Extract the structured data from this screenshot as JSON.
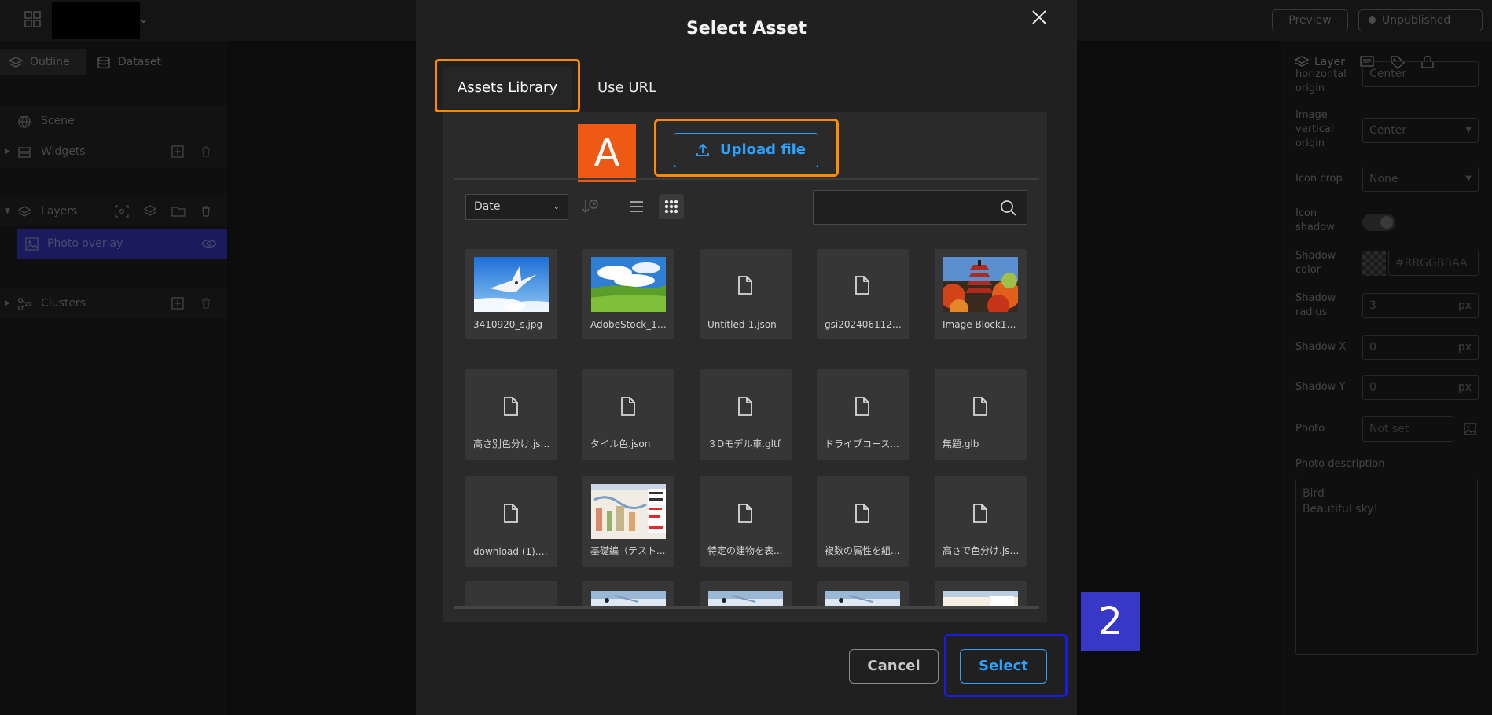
{
  "app": {
    "preview_label": "Preview",
    "publish_status": "Unpublished"
  },
  "left_panel": {
    "tabs": [
      {
        "label": "Outline"
      },
      {
        "label": "Dataset"
      }
    ],
    "scene_label": "Scene",
    "widgets_label": "Widgets",
    "layers_label": "Layers",
    "photo_overlay_label": "Photo overlay",
    "clusters_label": "Clusters"
  },
  "right_panel": {
    "tab_label": "Layer",
    "fields": {
      "horizontal_origin_label": "horizontal origin",
      "horizontal_origin_value": "Center",
      "vertical_origin_label": "Image vertical origin",
      "vertical_origin_value": "Center",
      "icon_crop_label": "Icon crop",
      "icon_crop_value": "None",
      "icon_shadow_label": "Icon shadow",
      "shadow_color_label": "Shadow color",
      "shadow_color_placeholder": "#RRGGBBAA",
      "shadow_radius_label": "Shadow radius",
      "shadow_radius_value": "3",
      "shadow_x_label": "Shadow X",
      "shadow_x_value": "0",
      "shadow_y_label": "Shadow Y",
      "shadow_y_value": "0",
      "px_unit": "px",
      "photo_label": "Photo",
      "photo_value": "Not set",
      "photo_description_label": "Photo description",
      "photo_description_line1": "Bird",
      "photo_description_line2": "Beautiful sky!"
    }
  },
  "modal": {
    "title": "Select Asset",
    "tabs": {
      "assets_library": "Assets Library",
      "use_url": "Use URL"
    },
    "upload_label": "Upload file",
    "sort_value": "Date",
    "search_placeholder": "",
    "assets": [
      {
        "name": "3410920_s.jpg",
        "kind": "image-bird"
      },
      {
        "name": "AdobeStock_16...",
        "kind": "image-field"
      },
      {
        "name": "Untitled-1.json",
        "kind": "file"
      },
      {
        "name": "gsi20240611221...",
        "kind": "file"
      },
      {
        "name": "Image Block11.j...",
        "kind": "image-pagoda"
      },
      {
        "name": "高さ別色分け.json",
        "kind": "file"
      },
      {
        "name": "タイル色.json",
        "kind": "file"
      },
      {
        "name": "３Dモデル車.gltf",
        "kind": "file"
      },
      {
        "name": "ドライブコース...",
        "kind": "file"
      },
      {
        "name": "無題.glb",
        "kind": "file"
      },
      {
        "name": "download (1).cz...",
        "kind": "file"
      },
      {
        "name": "基礎編（テスト...",
        "kind": "image-doc"
      },
      {
        "name": "特定の建物を表...",
        "kind": "file"
      },
      {
        "name": "複数の属性を組...",
        "kind": "file"
      },
      {
        "name": "高さで色分け.json",
        "kind": "file"
      }
    ],
    "cancel_label": "Cancel",
    "select_label": "Select"
  },
  "annotations": {
    "marker_a": "A",
    "marker_2": "2"
  },
  "colors": {
    "accent_blue": "#2aa2ff",
    "highlight_orange": "#ff8a00",
    "highlight_blue": "#1c1cdc",
    "marker_a_bg": "#ee5a14",
    "marker_2_bg": "#3838c8"
  }
}
